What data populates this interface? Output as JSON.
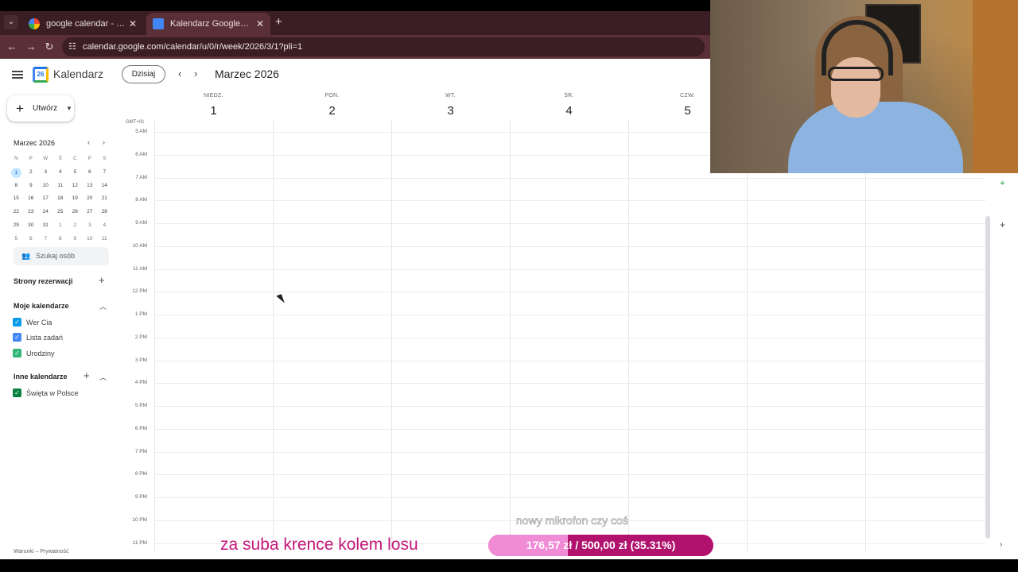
{
  "browser": {
    "tabs": [
      {
        "title": "google calendar - Szukaj w Goo",
        "active": false
      },
      {
        "title": "Kalendarz Google - Tydzień, w",
        "active": true
      }
    ],
    "url": "calendar.google.com/calendar/u/0/r/week/2026/3/1?pli=1"
  },
  "header": {
    "app_name": "Kalendarz",
    "logo_day": "26",
    "today_label": "Dzisiaj",
    "month_title": "Marzec 2026"
  },
  "sidebar": {
    "create_label": "Utwórz",
    "mini_calendar": {
      "title": "Marzec 2026",
      "weekdays": [
        "N",
        "P",
        "W",
        "Ś",
        "C",
        "P",
        "S"
      ],
      "weeks": [
        [
          "1",
          "2",
          "3",
          "4",
          "5",
          "6",
          "7"
        ],
        [
          "8",
          "9",
          "10",
          "11",
          "12",
          "13",
          "14"
        ],
        [
          "15",
          "16",
          "17",
          "18",
          "19",
          "20",
          "21"
        ],
        [
          "22",
          "23",
          "24",
          "25",
          "26",
          "27",
          "28"
        ],
        [
          "29",
          "30",
          "31",
          "1",
          "2",
          "3",
          "4"
        ],
        [
          "5",
          "6",
          "7",
          "8",
          "9",
          "10",
          "11"
        ]
      ]
    },
    "people_search": "Szukaj osób",
    "booking_pages": "Strony rezerwacji",
    "my_calendars_title": "Moje kalendarze",
    "my_calendars": [
      {
        "name": "Wer Cia",
        "color": "#039be5"
      },
      {
        "name": "Lista zadań",
        "color": "#4285f4"
      },
      {
        "name": "Urodziny",
        "color": "#33b679"
      }
    ],
    "other_calendars_title": "Inne kalendarze",
    "other_calendars": [
      {
        "name": "Święta w Polsce",
        "color": "#0b8043"
      }
    ],
    "footer": "Warunki – Prywatność"
  },
  "week": {
    "timezone": "GMT+01",
    "days": [
      {
        "name": "NIEDZ.",
        "date": "1"
      },
      {
        "name": "PON.",
        "date": "2"
      },
      {
        "name": "WT.",
        "date": "3"
      },
      {
        "name": "ŚR.",
        "date": "4"
      },
      {
        "name": "CZW.",
        "date": "5"
      }
    ],
    "hours": [
      "5 AM",
      "6 AM",
      "7 AM",
      "8 AM",
      "9 AM",
      "10 AM",
      "11 AM",
      "12 PM",
      "1 PM",
      "2 PM",
      "3 PM",
      "4 PM",
      "5 PM",
      "6 PM",
      "7 PM",
      "8 PM",
      "9 PM",
      "10 PM",
      "11 PM"
    ]
  },
  "stream": {
    "subtitle": "za suba krence kolem losu",
    "goal_caption": "nowy mikrofon czy coś",
    "goal_text": "176,57 zł / 500,00 zł (35.31%)",
    "goal_fraction": 0.3531
  }
}
